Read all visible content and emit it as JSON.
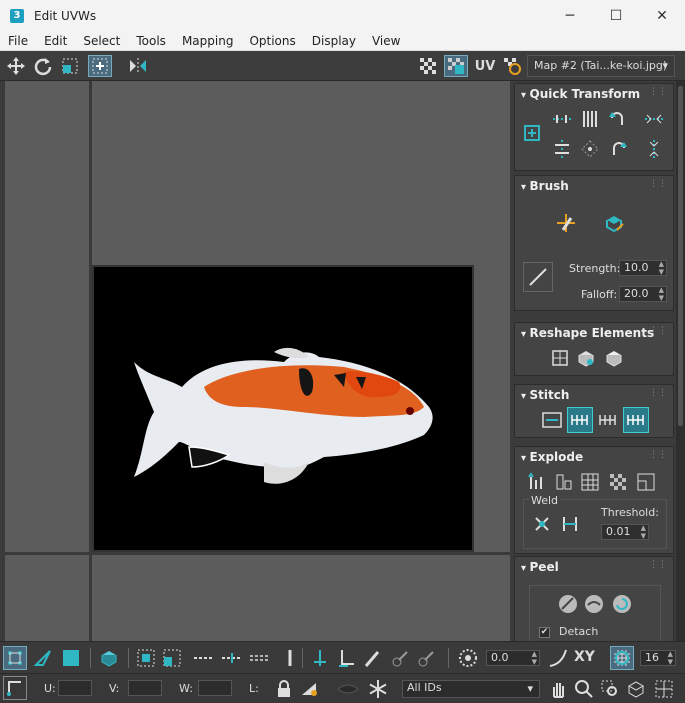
{
  "window": {
    "title": "Edit UVWs",
    "app_icon": "3",
    "minimize": "─",
    "maximize": "☐",
    "close": "✕"
  },
  "menu": [
    "File",
    "Edit",
    "Select",
    "Tools",
    "Mapping",
    "Options",
    "Display",
    "View"
  ],
  "toolbar": {
    "uv_label": "UV",
    "map_select": "Map #2 (Tai...ke-koi.jpg)"
  },
  "panel": {
    "quick_transform": {
      "title": "Quick Transform"
    },
    "brush": {
      "title": "Brush",
      "strength_label": "Strength:",
      "strength_value": "10.0",
      "falloff_label": "Falloff:",
      "falloff_value": "20.0"
    },
    "reshape": {
      "title": "Reshape Elements"
    },
    "stitch": {
      "title": "Stitch"
    },
    "explode": {
      "title": "Explode",
      "weld_label": "Weld",
      "threshold_label": "Threshold:",
      "threshold_value": "0.01"
    },
    "peel": {
      "title": "Peel",
      "detach_label": "Detach",
      "detach_checked": true
    }
  },
  "bottom": {
    "angle_value": "0.0",
    "xy_label": "XY",
    "grid_value": "16",
    "u_label": "U:",
    "v_label": "V:",
    "w_label": "W:",
    "l_label": "L:",
    "ids_select": "All IDs"
  },
  "colors": {
    "accent": "#2fb8c4",
    "panel_bg": "#444444",
    "viewport_bg": "#5c5c5c"
  }
}
